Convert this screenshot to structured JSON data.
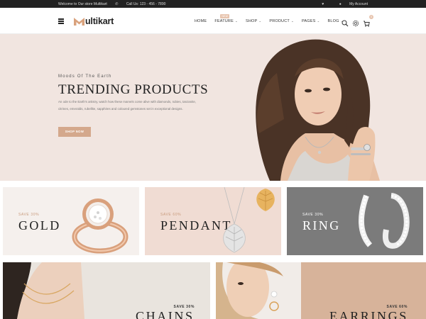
{
  "topbar": {
    "welcome": "Welcome to Our store Multikart",
    "phone": "Call Us: 123 - 456 - 7890",
    "wishlist_icon": "heart-icon",
    "account": "My Account"
  },
  "header": {
    "logo_text": "ultikart",
    "nav": [
      {
        "label": "HOME",
        "caret": false
      },
      {
        "label": "FEATURE",
        "caret": true,
        "badge": "NEW"
      },
      {
        "label": "SHOP",
        "caret": true
      },
      {
        "label": "PRODUCT",
        "caret": true
      },
      {
        "label": "PAGES",
        "caret": true
      },
      {
        "label": "BLOG",
        "caret": true
      }
    ],
    "cart_count": "0",
    "accent": "#e7c4ae"
  },
  "hero": {
    "subtitle": "Moods Of The Earth",
    "title": "TRENDING PRODUCTS",
    "description": "An ode to the Earth's artistry, watch how these marvels come alive with diamonds, rubies, tanzanite, citrines, emeralds, rubellite, sapphires and coloured gemstones set in exceptional designs.",
    "button": "SHOP NOW",
    "background": "#f1e5e0",
    "button_color": "#d4a88c"
  },
  "categories": [
    {
      "save": "SAVE 30%",
      "name": "GOLD",
      "background": "#f5f0ed"
    },
    {
      "save": "SAVE 60%",
      "name": "PENDANT",
      "background": "#f0dcd3"
    },
    {
      "save": "SAVE 30%",
      "name": "RING",
      "background": "#7b7b7b"
    }
  ],
  "banners": [
    {
      "save": "SAVE 30%",
      "name": "CHAINS",
      "background": "#e9e4de"
    },
    {
      "save": "SAVE 60%",
      "name": "EARRINGS",
      "background": "#d7b39a"
    }
  ]
}
